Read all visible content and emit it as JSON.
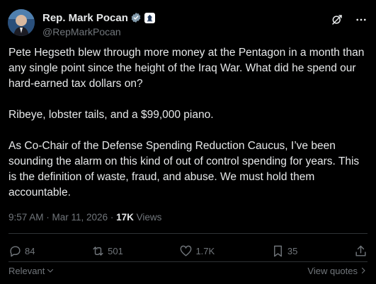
{
  "author": {
    "name": "Rep. Mark Pocan",
    "handle": "@RepMarkPocan"
  },
  "post": {
    "text": "Pete Hegseth blew through more money at the Pentagon in a month than any single point since the height of the Iraq War. What did he spend our hard-earned tax dollars on?\n\nRibeye, lobster tails, and a $99,000 piano.\n\nAs Co-Chair of the Defense Spending Reduction Caucus, I’ve been sounding the alarm on this kind of out of control spending for years. This is the definition of waste, fraud, and abuse. We must hold them accountable.",
    "timestamp": "9:57 AM · Mar 11, 2026 · ",
    "views_count": "17K",
    "views_label": " Views"
  },
  "actions": {
    "replies": "84",
    "reposts": "501",
    "likes": "1.7K",
    "bookmarks": "35"
  },
  "footer": {
    "sort_label": "Relevant",
    "quotes_label": "View quotes"
  },
  "colors": {
    "background": "#000000",
    "text": "#e7e9ea",
    "muted": "#71767b",
    "verified": "#1d9bf0"
  }
}
